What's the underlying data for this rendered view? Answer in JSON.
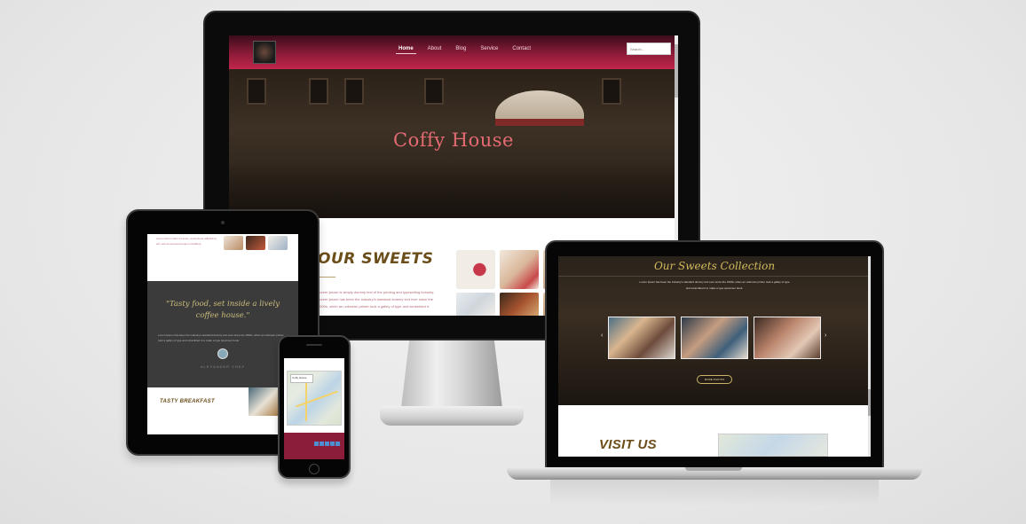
{
  "desktop": {
    "nav": {
      "items": [
        "Home",
        "About",
        "Blog",
        "Service",
        "Contact"
      ],
      "active": "Home",
      "search_placeholder": "Search..."
    },
    "hero_title": "Coffy House",
    "section_title": "OUR SWEETS",
    "section_text": "Lorem Ipsum is simply dummy text of the printing and typesetting industry. Lorem Ipsum has been the industry's standard dummy text ever since the 1500s, when an unknown printer took a galley of type and scrambled it."
  },
  "tablet": {
    "top_text": "Lorem ipsum dolor sit amet, consectetur adipiscing elit, sed do eiusmod tempor incididunt.",
    "quote": "\"Tasty food, set inside a lively coffee house.\"",
    "quote_body": "Lorem Ipsum has been the industry's standard dummy text ever since the 1500s, when an unknown printer took a galley of type and scrambled it to make a type specimen book.",
    "quote_author": "ALEXANDER CHEF",
    "breakfast_label": "TASTY BREAKFAST"
  },
  "phone": {
    "map_label": "Coffy House"
  },
  "laptop": {
    "title": "Our Sweets Collection",
    "text": "Lorem Ipsum has been the industry's standard dummy text ever since the 1500s, when an unknown printer took a galley of type and scrambled it to make a type specimen book.",
    "prev_glyph": "‹",
    "next_glyph": "›",
    "button_label": "MORE PHOTOS",
    "visit_title": "VISIT US"
  },
  "colors": {
    "accent": "#c2264c",
    "hero_title": "#e46a72",
    "heading_brown": "#6b4d1a",
    "gold": "#d1b95a"
  }
}
